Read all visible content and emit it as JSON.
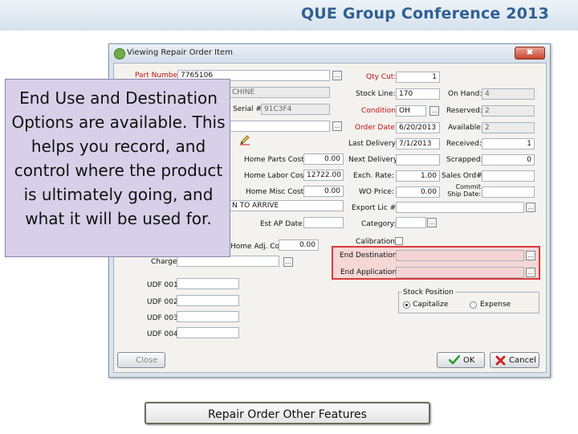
{
  "slide": {
    "conference_title": "QUE Group Conference 2013",
    "callout_text": "End Use and Destination Options are available. This helps you record, and control where the product is ultimately going, and what it will be used for.",
    "caption": "Repair Order Other Features"
  },
  "window": {
    "title": "Viewing Repair Order Item",
    "close_glyph": "✖",
    "ellipsis": "..."
  },
  "form": {
    "part_number": {
      "label": "Part Number:",
      "value": "7765106"
    },
    "description": {
      "value": "CHINE"
    },
    "serial": {
      "label": "Serial #:",
      "value": "91C3F4"
    },
    "qty_cut": {
      "label": "Qty Cut:",
      "value": "1"
    },
    "stock_line": {
      "label": "Stock Line:",
      "value": "170"
    },
    "on_hand": {
      "label": "On Hand:",
      "value": "4"
    },
    "condition": {
      "label": "Condition:",
      "value": "OH"
    },
    "reserved": {
      "label": "Reserved:",
      "value": "2"
    },
    "order_date": {
      "label": "Order Date:",
      "value": "6/20/2013"
    },
    "available": {
      "label": "Available:",
      "value": "2"
    },
    "last_delivery": {
      "label": "Last Delivery:",
      "value": "7/1/2013"
    },
    "received": {
      "label": "Received:",
      "value": "1"
    },
    "home_parts_cost": {
      "label": "Home Parts Cost:",
      "value": "0.00"
    },
    "next_delivery": {
      "label": "Next Delivery:",
      "value": ""
    },
    "scrapped": {
      "label": "Scrapped:",
      "value": "0"
    },
    "home_labor_cost": {
      "label": "Home Labor Cost:",
      "value": "12722.00"
    },
    "exch_rate": {
      "label": "Exch. Rate:",
      "value": "1.00"
    },
    "sales_ord": {
      "label": "Sales Ord#:",
      "value": ""
    },
    "home_misc_cost": {
      "label": "Home Misc Cost:",
      "value": "0.00"
    },
    "wo_price": {
      "label": "WO Price:",
      "value": "0.00"
    },
    "commit_ship_date": {
      "label": "Commit Ship Date:",
      "value": ""
    },
    "status_text": {
      "value": "N TO ARRIVE"
    },
    "export_lic": {
      "label": "Export Lic #:",
      "value": ""
    },
    "est_ap_date": {
      "label": "Est AP Date:",
      "value": ""
    },
    "category": {
      "label": "Category:",
      "value": ""
    },
    "home_adj_cost": {
      "label": "Home Adj. Cost:",
      "value": "0.00"
    },
    "calibration": {
      "label": "Calibration:"
    },
    "charge": {
      "label": "Charge"
    },
    "end_destination": {
      "label": "End Destination:",
      "value": ""
    },
    "end_application": {
      "label": "End Application:",
      "value": ""
    },
    "udf": [
      {
        "label": "UDF 001",
        "value": ""
      },
      {
        "label": "UDF 002",
        "value": ""
      },
      {
        "label": "UDF 003",
        "value": ""
      },
      {
        "label": "UDF 004",
        "value": ""
      }
    ],
    "stock_position": {
      "label": "Stock Position",
      "options": [
        "Capitalize",
        "Expense"
      ],
      "selected": "Capitalize"
    }
  },
  "buttons": {
    "close": "Close",
    "ok": "OK",
    "cancel": "Cancel"
  },
  "colors": {
    "required_label": "#c21010",
    "highlight_border": "#d83a3a",
    "callout_bg": "#d8d0e8",
    "conference_title": "#2f5f93"
  },
  "icons": [
    "app-icon",
    "close-icon",
    "ellipsis-icon",
    "edit-pencil-icon",
    "checkmark-icon",
    "cancel-x-icon"
  ]
}
